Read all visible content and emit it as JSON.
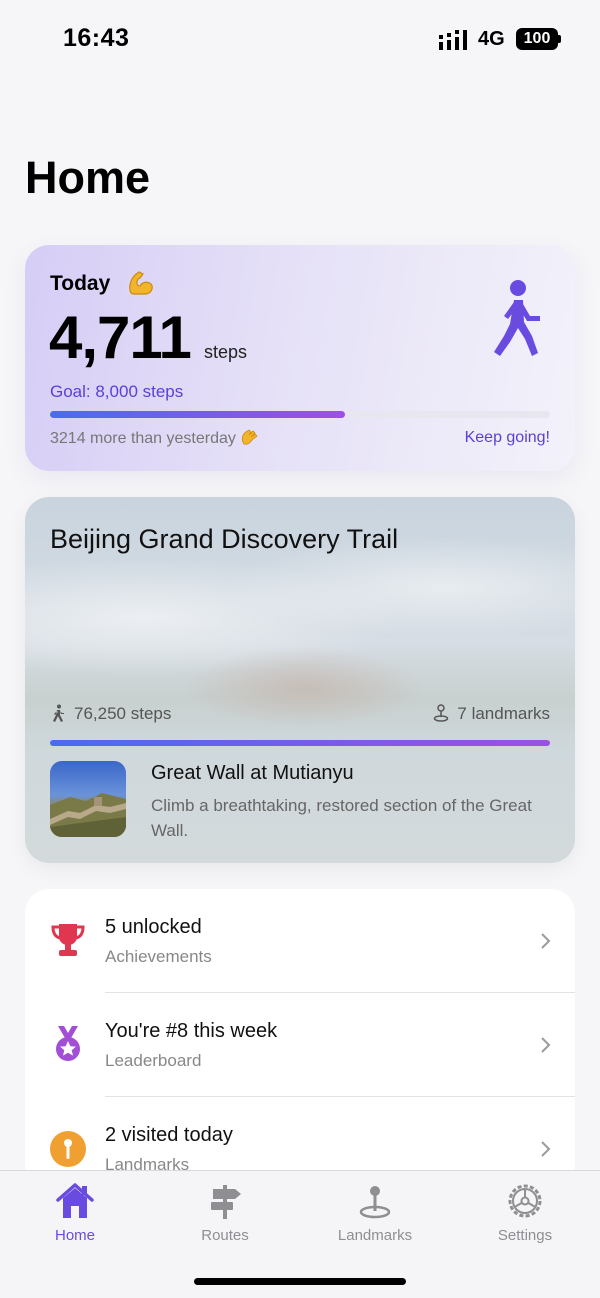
{
  "status": {
    "time": "16:43",
    "network": "4G",
    "battery": "100"
  },
  "page": {
    "title": "Home"
  },
  "today": {
    "label": "Today",
    "steps": "4,711",
    "unit": "steps",
    "goal": "Goal: 8,000 steps",
    "progress": 0.589,
    "compare": "3214 more than yesterday",
    "encouragement": "Keep going!",
    "accent": "#5b3fd6"
  },
  "trail": {
    "title": "Beijing Grand Discovery Trail",
    "steps": "76,250 steps",
    "landmarks": "7 landmarks",
    "progress": 1.0,
    "landmark": {
      "name": "Great Wall at Mutianyu",
      "description": "Climb a breathtaking, restored section of the Great Wall."
    }
  },
  "stats": [
    {
      "icon": "trophy-icon",
      "title": "5 unlocked",
      "subtitle": "Achievements",
      "color": "#e0364f"
    },
    {
      "icon": "medal-icon",
      "title": "You're #8 this week",
      "subtitle": "Leaderboard",
      "color": "#a24fd6"
    },
    {
      "icon": "pin-icon",
      "title": "2 visited today",
      "subtitle": "Landmarks",
      "color": "#f0a030"
    }
  ],
  "tabs": [
    {
      "label": "Home",
      "icon": "house-icon",
      "active": true
    },
    {
      "label": "Routes",
      "icon": "signpost-icon",
      "active": false
    },
    {
      "label": "Landmarks",
      "icon": "map-pin-icon",
      "active": false
    },
    {
      "label": "Settings",
      "icon": "gear-icon",
      "active": false
    }
  ]
}
